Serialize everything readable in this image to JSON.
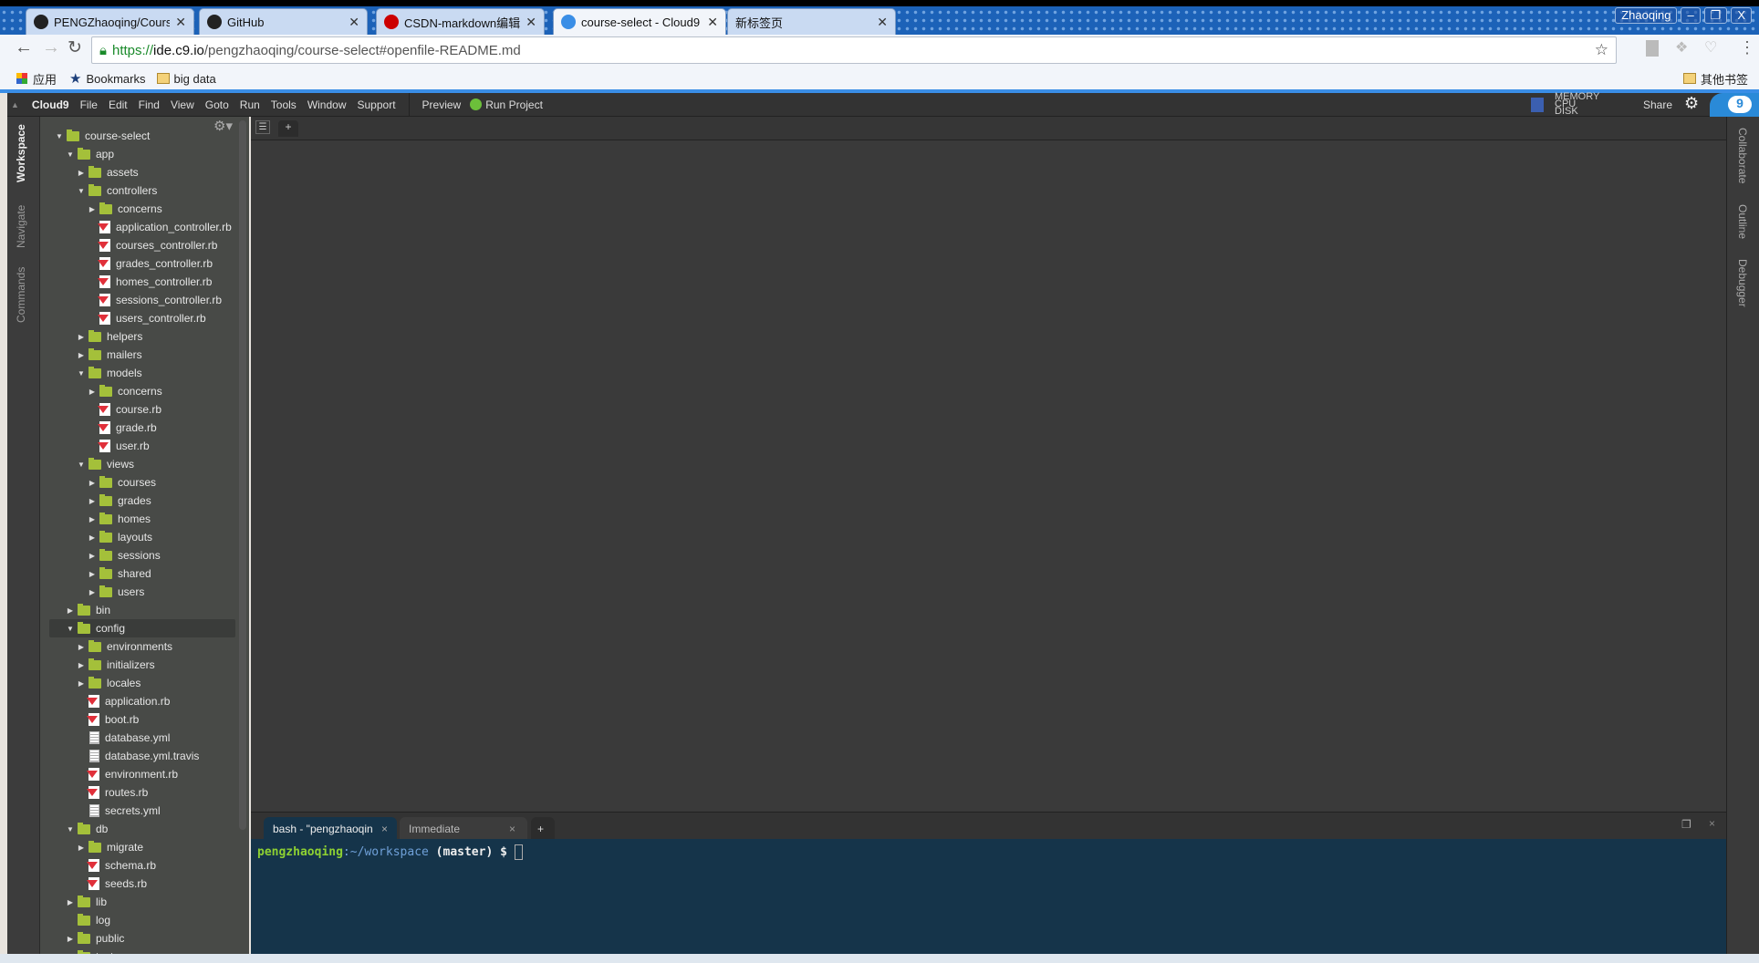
{
  "browser": {
    "tabs": [
      {
        "label": "PENGZhaoqing/Course",
        "icon": "github-icon"
      },
      {
        "label": "GitHub",
        "icon": "github-icon"
      },
      {
        "label": "CSDN-markdown编辑器",
        "icon": "csdn-icon"
      },
      {
        "label": "course-select - Cloud9",
        "icon": "cloud9-icon",
        "active": true
      },
      {
        "label": "新标签页",
        "icon": ""
      }
    ],
    "user": "Zhaoqing",
    "url_scheme": "https://",
    "url_host": "ide.c9.io",
    "url_path": "/pengzhaoqing/course-select#openfile-README.md",
    "bookmarks": [
      {
        "label": "应用",
        "icon": "apps-icon"
      },
      {
        "label": "Bookmarks",
        "icon": "star-icon"
      },
      {
        "label": "big data",
        "icon": "folder-icon"
      }
    ],
    "other_bookmarks": "其他书签"
  },
  "ide": {
    "brand": "Cloud9",
    "menu": [
      "File",
      "Edit",
      "Find",
      "View",
      "Goto",
      "Run",
      "Tools",
      "Window",
      "Support"
    ],
    "preview": "Preview",
    "run_project": "Run Project",
    "stats": [
      "MEMORY",
      "CPU",
      "DISK"
    ],
    "share": "Share",
    "left_tabs": [
      "Workspace",
      "Navigate",
      "Commands"
    ],
    "right_tabs": [
      "Collaborate",
      "Outline",
      "Debugger"
    ],
    "tree": [
      {
        "n": "course-select",
        "l": 0,
        "t": "dir",
        "open": true
      },
      {
        "n": "app",
        "l": 1,
        "t": "dir",
        "open": true
      },
      {
        "n": "assets",
        "l": 2,
        "t": "dir"
      },
      {
        "n": "controllers",
        "l": 2,
        "t": "dir",
        "open": true
      },
      {
        "n": "concerns",
        "l": 3,
        "t": "dir"
      },
      {
        "n": "application_controller.rb",
        "l": 3,
        "t": "rb"
      },
      {
        "n": "courses_controller.rb",
        "l": 3,
        "t": "rb"
      },
      {
        "n": "grades_controller.rb",
        "l": 3,
        "t": "rb"
      },
      {
        "n": "homes_controller.rb",
        "l": 3,
        "t": "rb"
      },
      {
        "n": "sessions_controller.rb",
        "l": 3,
        "t": "rb"
      },
      {
        "n": "users_controller.rb",
        "l": 3,
        "t": "rb"
      },
      {
        "n": "helpers",
        "l": 2,
        "t": "dir"
      },
      {
        "n": "mailers",
        "l": 2,
        "t": "dir"
      },
      {
        "n": "models",
        "l": 2,
        "t": "dir",
        "open": true
      },
      {
        "n": "concerns",
        "l": 3,
        "t": "dir"
      },
      {
        "n": "course.rb",
        "l": 3,
        "t": "rb"
      },
      {
        "n": "grade.rb",
        "l": 3,
        "t": "rb"
      },
      {
        "n": "user.rb",
        "l": 3,
        "t": "rb"
      },
      {
        "n": "views",
        "l": 2,
        "t": "dir",
        "open": true
      },
      {
        "n": "courses",
        "l": 3,
        "t": "dir"
      },
      {
        "n": "grades",
        "l": 3,
        "t": "dir"
      },
      {
        "n": "homes",
        "l": 3,
        "t": "dir"
      },
      {
        "n": "layouts",
        "l": 3,
        "t": "dir"
      },
      {
        "n": "sessions",
        "l": 3,
        "t": "dir"
      },
      {
        "n": "shared",
        "l": 3,
        "t": "dir"
      },
      {
        "n": "users",
        "l": 3,
        "t": "dir"
      },
      {
        "n": "bin",
        "l": 1,
        "t": "dir"
      },
      {
        "n": "config",
        "l": 1,
        "t": "dir",
        "open": true,
        "selected": true
      },
      {
        "n": "environments",
        "l": 2,
        "t": "dir"
      },
      {
        "n": "initializers",
        "l": 2,
        "t": "dir"
      },
      {
        "n": "locales",
        "l": 2,
        "t": "dir"
      },
      {
        "n": "application.rb",
        "l": 2,
        "t": "rb"
      },
      {
        "n": "boot.rb",
        "l": 2,
        "t": "rb"
      },
      {
        "n": "database.yml",
        "l": 2,
        "t": "file"
      },
      {
        "n": "database.yml.travis",
        "l": 2,
        "t": "file"
      },
      {
        "n": "environment.rb",
        "l": 2,
        "t": "rb"
      },
      {
        "n": "routes.rb",
        "l": 2,
        "t": "rb"
      },
      {
        "n": "secrets.yml",
        "l": 2,
        "t": "file"
      },
      {
        "n": "db",
        "l": 1,
        "t": "dir",
        "open": true
      },
      {
        "n": "migrate",
        "l": 2,
        "t": "dir"
      },
      {
        "n": "schema.rb",
        "l": 2,
        "t": "rb"
      },
      {
        "n": "seeds.rb",
        "l": 2,
        "t": "rb"
      },
      {
        "n": "lib",
        "l": 1,
        "t": "dir"
      },
      {
        "n": "log",
        "l": 1,
        "t": "dir",
        "noarrow": true
      },
      {
        "n": "public",
        "l": 1,
        "t": "dir"
      },
      {
        "n": "test",
        "l": 1,
        "t": "dir"
      }
    ],
    "terminal": {
      "tabs": [
        {
          "label": "bash - \"pengzhaoqin",
          "active": true
        },
        {
          "label": "Immediate"
        }
      ],
      "prompt_user": "pengzhaoqing",
      "prompt_path": ":~/workspace",
      "prompt_rest": " (master) $ "
    }
  },
  "colors": {
    "terminal_bg": "#15344a",
    "prompt_user": "#8ed132",
    "prompt_path": "#6fa0d8",
    "folder": "#a4c03a",
    "accent": "#3a8ee6"
  }
}
